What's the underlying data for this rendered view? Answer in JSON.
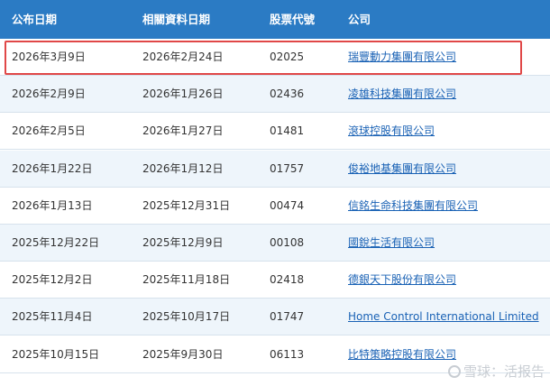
{
  "headers": {
    "announce_date": "公布日期",
    "doc_date": "相關資料日期",
    "stock_code": "股票代號",
    "company": "公司"
  },
  "rows": [
    {
      "announce_date": "2026年3月9日",
      "doc_date": "2026年2月24日",
      "stock_code": "02025",
      "company": "瑞豐動力集團有限公司"
    },
    {
      "announce_date": "2026年2月9日",
      "doc_date": "2026年1月26日",
      "stock_code": "02436",
      "company": "凌雄科技集團有限公司"
    },
    {
      "announce_date": "2026年2月5日",
      "doc_date": "2026年1月27日",
      "stock_code": "01481",
      "company": "滾球控股有限公司"
    },
    {
      "announce_date": "2026年1月22日",
      "doc_date": "2026年1月12日",
      "stock_code": "01757",
      "company": "俊裕地基集團有限公司"
    },
    {
      "announce_date": "2026年1月13日",
      "doc_date": "2025年12月31日",
      "stock_code": "00474",
      "company": "信銘生命科技集團有限公司"
    },
    {
      "announce_date": "2025年12月22日",
      "doc_date": "2025年12月9日",
      "stock_code": "00108",
      "company": "國銳生活有限公司"
    },
    {
      "announce_date": "2025年12月2日",
      "doc_date": "2025年11月18日",
      "stock_code": "02418",
      "company": "德銀天下股份有限公司"
    },
    {
      "announce_date": "2025年11月4日",
      "doc_date": "2025年10月17日",
      "stock_code": "01747",
      "company": "Home Control International Limited"
    },
    {
      "announce_date": "2025年10月15日",
      "doc_date": "2025年9月30日",
      "stock_code": "06113",
      "company": "比特策略控股有限公司"
    }
  ],
  "watermark": "雪球：活报告",
  "colors": {
    "header_bg": "#2b7bc4",
    "link": "#1a62b5",
    "highlight": "#e04848",
    "alt_row": "#eef5fb"
  }
}
